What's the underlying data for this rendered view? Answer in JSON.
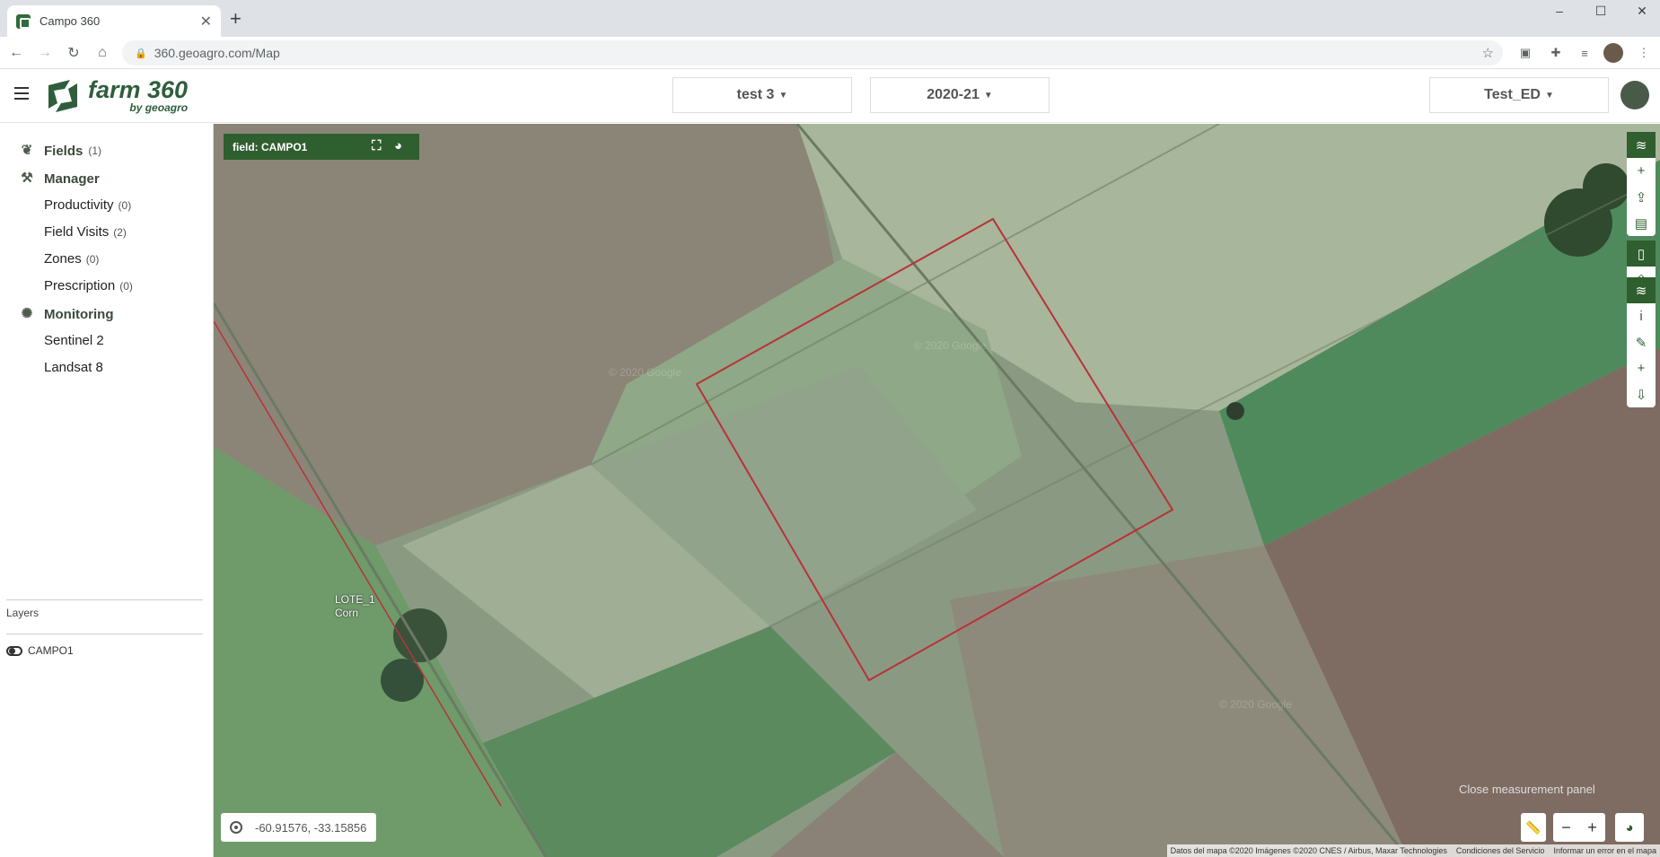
{
  "browser": {
    "tab_title": "Campo 360",
    "tab_close": "✕",
    "new_tab": "+",
    "url": "360.geoagro.com/Map",
    "window_controls": {
      "minimize": "–",
      "maximize": "☐",
      "close": "✕"
    }
  },
  "header": {
    "logo_main": "farm 360",
    "logo_sub": "by geoagro",
    "dropdown_farm": "test 3",
    "dropdown_season": "2020-21",
    "dropdown_user": "Test_ED"
  },
  "sidebar": {
    "fields": {
      "label": "Fields",
      "count": "(1)"
    },
    "manager": {
      "label": "Manager"
    },
    "manager_items": [
      {
        "label": "Productivity",
        "count": "(0)"
      },
      {
        "label": "Field Visits",
        "count": "(2)"
      },
      {
        "label": "Zones",
        "count": "(0)"
      },
      {
        "label": "Prescription",
        "count": "(0)"
      }
    ],
    "monitoring": {
      "label": "Monitoring"
    },
    "monitoring_items": [
      {
        "label": "Sentinel 2"
      },
      {
        "label": "Landsat 8"
      }
    ],
    "layers_title": "Layers",
    "layers": [
      {
        "label": "CAMPO1"
      }
    ]
  },
  "map": {
    "field_label": "field: CAMPO1",
    "lot_name": "LOTE_1",
    "lot_crop": "Corn",
    "coordinates": "-60.91576, -33.15856",
    "close_measurement": "Close measurement panel",
    "zoom_out": "−",
    "zoom_in": "+",
    "attribution": {
      "data": "Datos del mapa ©2020 Imágenes ©2020 CNES / Airbus, Maxar Technologies",
      "terms": "Condiciones del Servicio",
      "report": "Informar un error en el mapa"
    },
    "field_outline_color": "#b8323a",
    "accent_color": "#2f5e2f"
  }
}
